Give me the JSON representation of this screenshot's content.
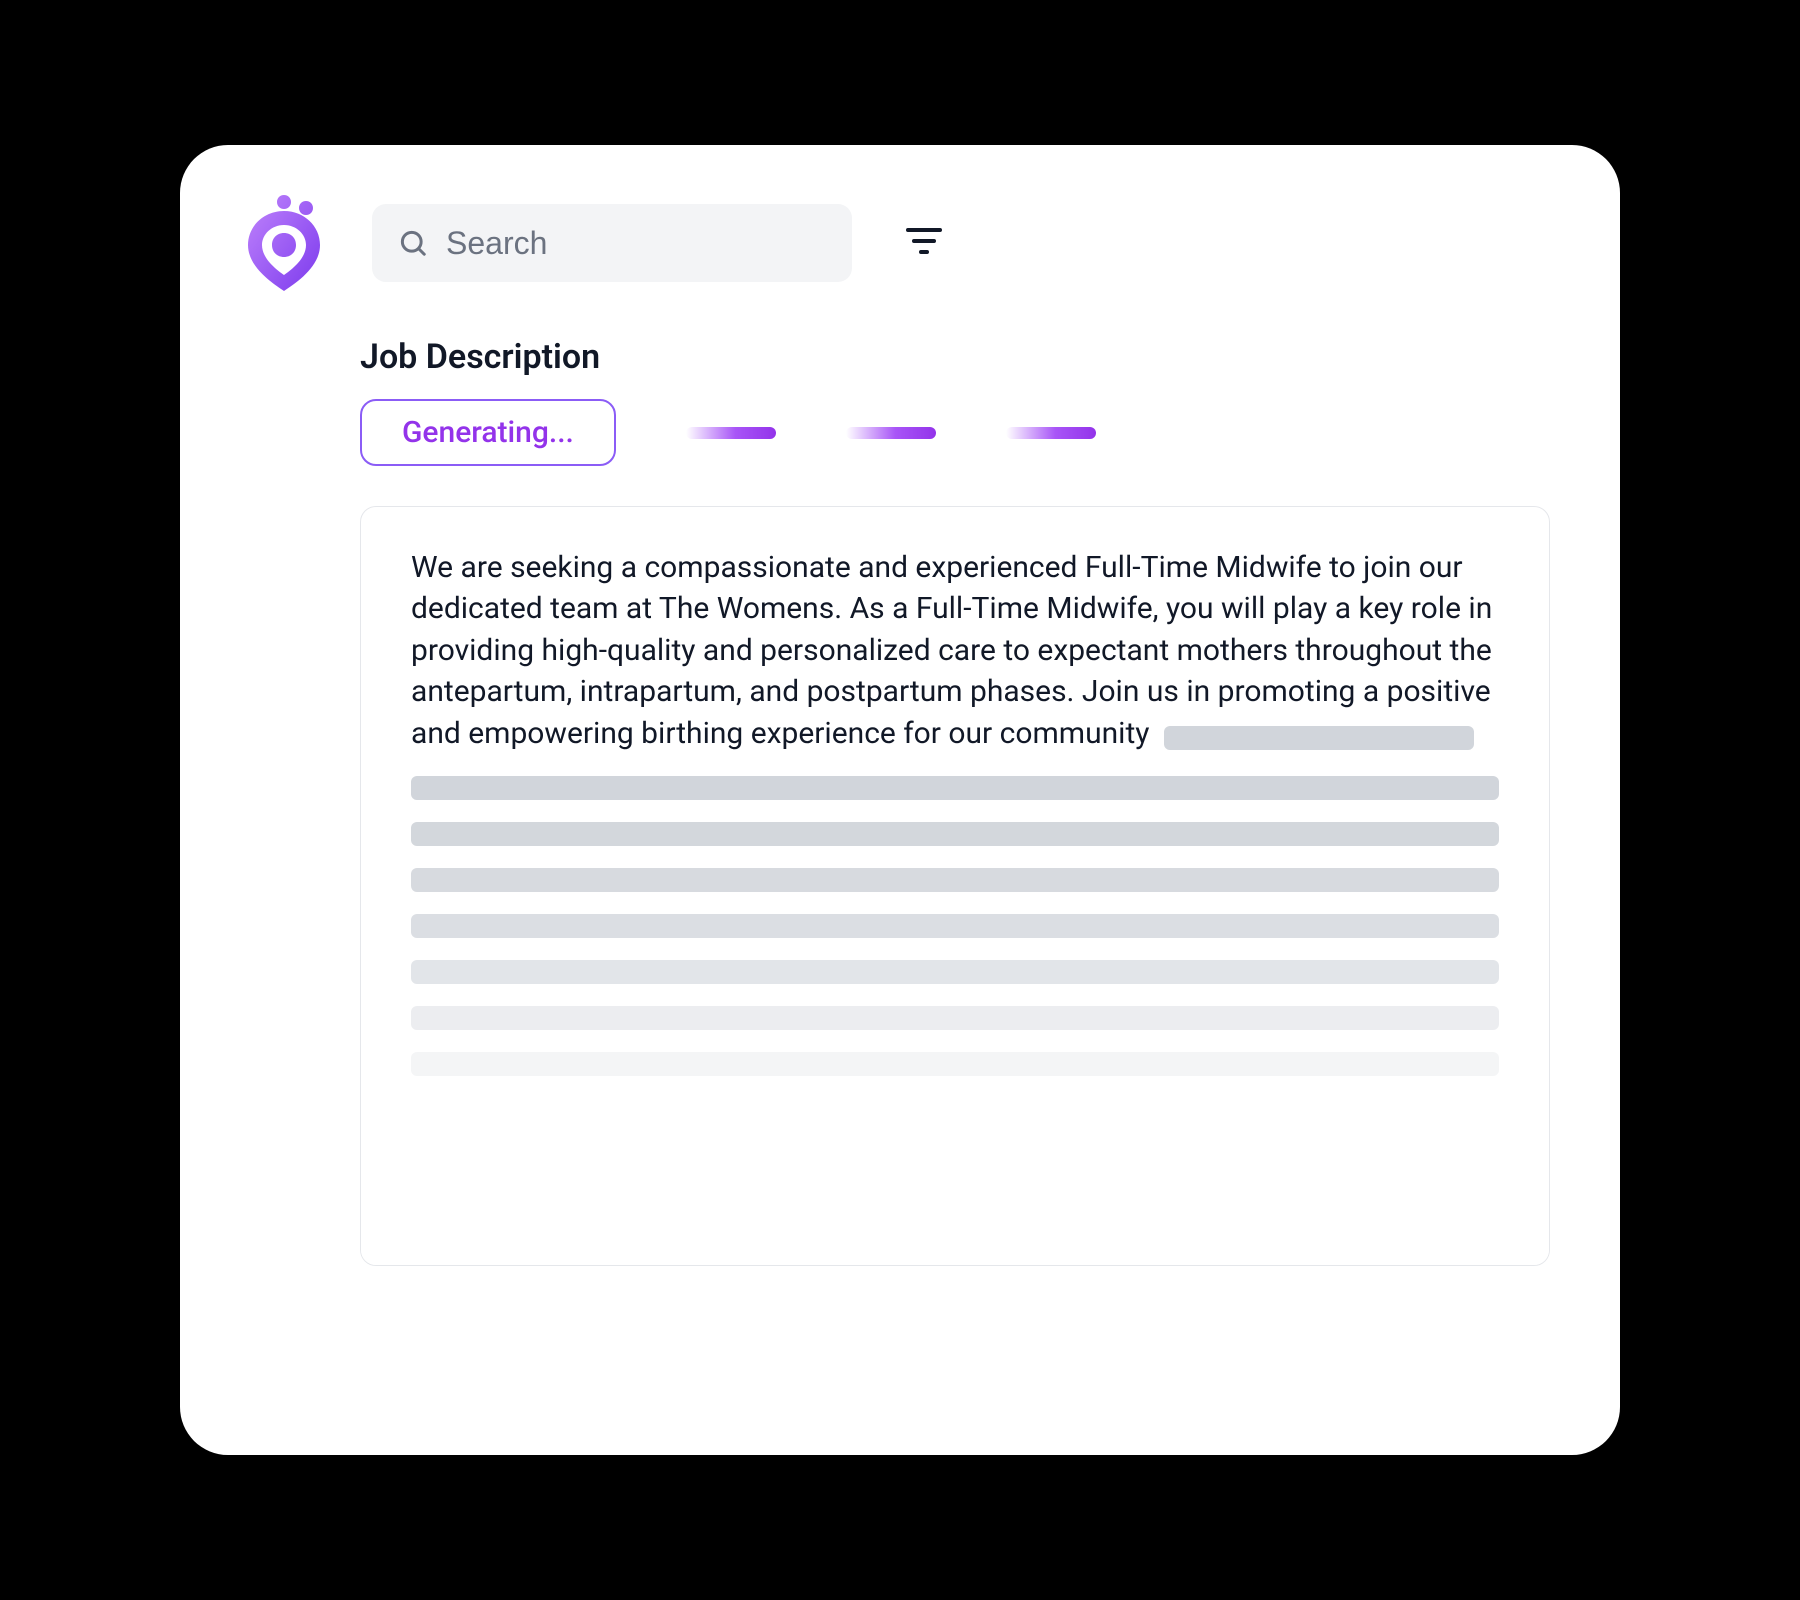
{
  "header": {
    "search_placeholder": "Search"
  },
  "section": {
    "title": "Job Description",
    "status_label": "Generating..."
  },
  "content": {
    "body": "We are seeking a compassionate and experienced Full-Time Midwife to join our dedicated team at The Womens. As a Full-Time Midwife, you will play a key role in providing high-quality and personalized care to expectant mothers throughout the antepartum, intrapartum, and postpartum phases. Join us in promoting a positive and empowering birthing experience for our community"
  },
  "colors": {
    "accent": "#9333ea",
    "skeleton": "#d1d5db"
  },
  "icons": {
    "logo": "location-pin-icon",
    "search": "search-icon",
    "filter": "filter-icon"
  }
}
